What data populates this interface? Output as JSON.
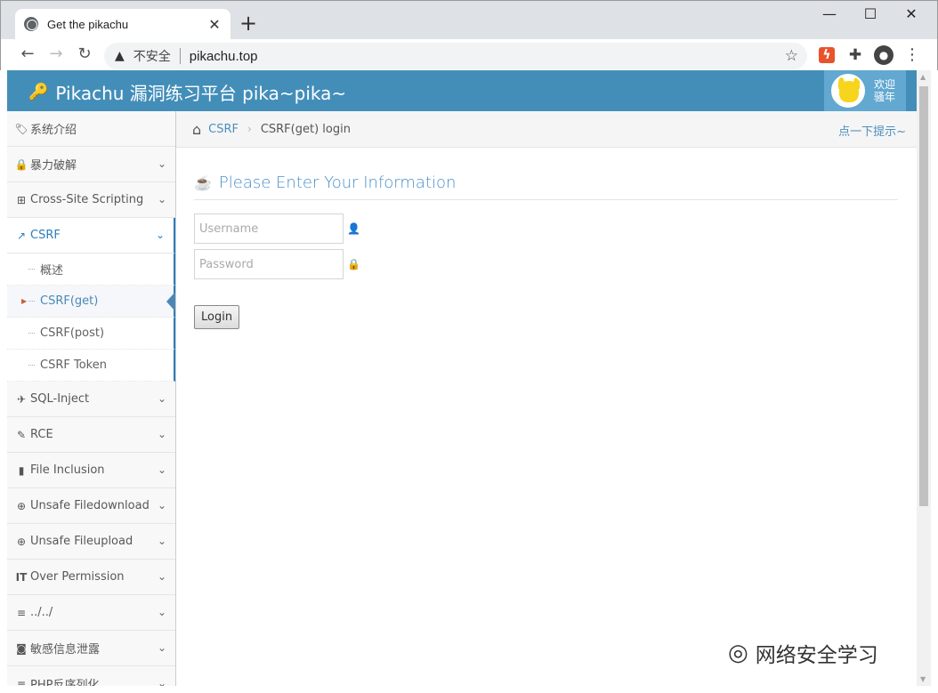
{
  "browser": {
    "tab_title": "Get the pikachu",
    "new_tab": "+",
    "security_label": "不安全",
    "url": "pikachu.top",
    "window_controls": {
      "minimize": "—",
      "maximize": "☐",
      "close": "✕"
    }
  },
  "header": {
    "brand": "Pikachu 漏洞练习平台 pika~pika~",
    "welcome": "欢迎",
    "welcome_sub": "骚年"
  },
  "sidebar": {
    "items": [
      {
        "label": "系统介绍",
        "icon": "tags-icon",
        "glyph": "🏷",
        "expandable": false
      },
      {
        "label": "暴力破解",
        "icon": "lock-icon",
        "glyph": "🔒",
        "expandable": true
      },
      {
        "label": "Cross-Site Scripting",
        "icon": "sitemap-icon",
        "glyph": "⊞",
        "expandable": true
      },
      {
        "label": "CSRF",
        "icon": "share-icon",
        "glyph": "↗",
        "expandable": true,
        "active": true
      }
    ],
    "csrf_sub": [
      {
        "label": "概述"
      },
      {
        "label": "CSRF(get)",
        "current": true
      },
      {
        "label": "CSRF(post)"
      },
      {
        "label": "CSRF Token"
      }
    ],
    "items_after": [
      {
        "label": "SQL-Inject",
        "icon": "plane-icon",
        "glyph": "✈"
      },
      {
        "label": "RCE",
        "icon": "pencil-icon",
        "glyph": "✎"
      },
      {
        "label": "File Inclusion",
        "icon": "file-icon",
        "glyph": "▮"
      },
      {
        "label": "Unsafe Filedownload",
        "icon": "download-icon",
        "glyph": "⊕"
      },
      {
        "label": "Unsafe Fileupload",
        "icon": "upload-icon",
        "glyph": "⊕"
      },
      {
        "label": "Over Permission",
        "icon": "text-width-icon",
        "glyph": "IT"
      },
      {
        "label": "../../",
        "icon": "align-left-icon",
        "glyph": "≡"
      },
      {
        "label": "敏感信息泄露",
        "icon": "camera-icon",
        "glyph": "◙"
      },
      {
        "label": "PHP反序列化",
        "icon": "align-left-icon",
        "glyph": "≡"
      }
    ]
  },
  "breadcrumbs": {
    "link": "CSRF",
    "current": "CSRF(get) login",
    "hint": "点一下提示~"
  },
  "form": {
    "title": "Please Enter Your Information",
    "username_placeholder": "Username",
    "password_placeholder": "Password",
    "login_label": "Login"
  },
  "watermark": "网络安全学习"
}
